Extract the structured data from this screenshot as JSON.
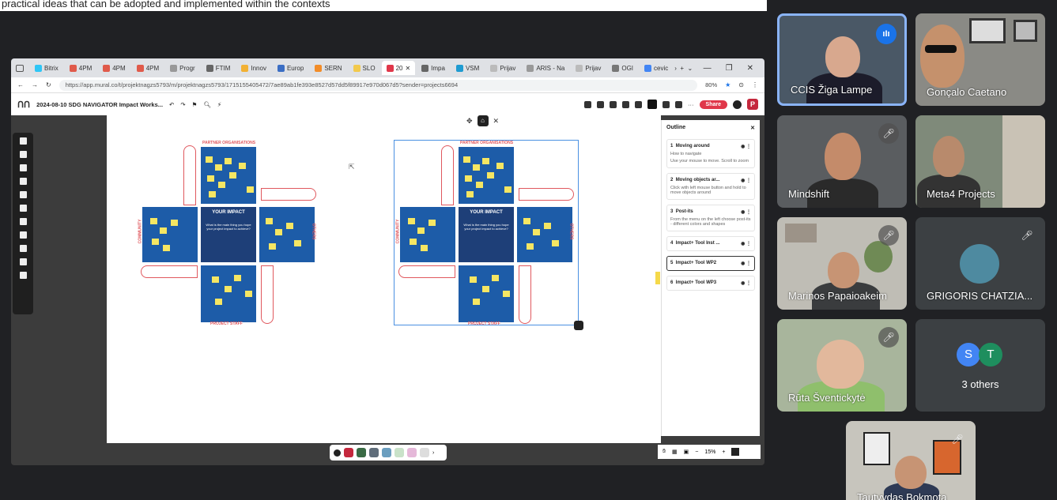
{
  "caption_text": "practical ideas that can be adopted and implemented within the contexts",
  "browser": {
    "tabs": [
      {
        "label": "Bitrix",
        "color": "#2fc6f6"
      },
      {
        "label": "4PM",
        "color": "#e05a4a"
      },
      {
        "label": "4PM",
        "color": "#e05a4a"
      },
      {
        "label": "4PM",
        "color": "#e05a4a"
      },
      {
        "label": "Progr",
        "color": "#999999"
      },
      {
        "label": "FTIM",
        "color": "#666666"
      },
      {
        "label": "Innov",
        "color": "#f2b134"
      },
      {
        "label": "Europ",
        "color": "#3b6ec4"
      },
      {
        "label": "SERN",
        "color": "#f28c28"
      },
      {
        "label": "SLO",
        "color": "#f2c94c"
      },
      {
        "label": "20",
        "color": "#e0374a",
        "active": true
      },
      {
        "label": "Impa",
        "color": "#666666"
      },
      {
        "label": "VSM",
        "color": "#1f9bd1"
      },
      {
        "label": "Prijav",
        "color": "#bbbbbb"
      },
      {
        "label": "ARIS - Na",
        "color": "#999999"
      },
      {
        "label": "Prijav",
        "color": "#bbbbbb"
      },
      {
        "label": "OGI",
        "color": "#777777"
      },
      {
        "label": "cevic",
        "color": "#4285f4"
      }
    ],
    "url": "https://app.mural.co/t/projektnagzs5793/m/projektnagzs5793/1715155405472/7ae89ab1fe393e8527d57dd5f89917e970d067d5?sender=projects6694",
    "zoom": "80%"
  },
  "mural": {
    "title": "2024-08-10 SDG NAVIGATOR Impact Works...",
    "share_label": "Share",
    "user_initial": "P",
    "board_labels": {
      "top": "PARTNER ORGANISATIONS",
      "bottom": "PROJECT STAFF",
      "center_title": "YOUR IMPACT",
      "center_text": "What is the main thing you hope your project impact to achieve?",
      "left": "COMMUNITY",
      "right": "OTHERS"
    },
    "zoom_level": "15%",
    "outline": {
      "title": "Outline",
      "items": [
        {
          "num": "1",
          "label": "Moving around",
          "sub": "How to navigate",
          "sub2": "Use your mouse to move. Scroll to zoom"
        },
        {
          "num": "2",
          "label": "Moving objects ar...",
          "sub": "Click with left mouse button and hold to move objects around"
        },
        {
          "num": "3",
          "label": "Post-its",
          "sub": "From the menu on the left choose post-its - different colors and shapes"
        },
        {
          "num": "4",
          "label": "Impact+ Tool Inst ..."
        },
        {
          "num": "5",
          "label": "Impact+ Tool WP2",
          "selected": true
        },
        {
          "num": "6",
          "label": "Impact+ Tool WP3"
        }
      ]
    }
  },
  "participants": [
    {
      "name": "CCIS Žiga Lampe",
      "speaking": true
    },
    {
      "name": "Gonçalo Caetano"
    },
    {
      "name": "Mindshift",
      "muted": true
    },
    {
      "name": "Meta4 Projects"
    },
    {
      "name": "Marinos Papaioakeim",
      "muted": true
    },
    {
      "name": "GRIGORIS CHATZIA...",
      "muted": true
    },
    {
      "name": "Rūta Šventickytė",
      "muted": true
    },
    {
      "name": "3 others",
      "initials": [
        "S",
        "T"
      ]
    },
    {
      "name": "Tautvydas Bokmota",
      "muted": true
    }
  ],
  "icons": {
    "mute": "mic-off-icon",
    "speaking": "audio-wave-icon"
  }
}
